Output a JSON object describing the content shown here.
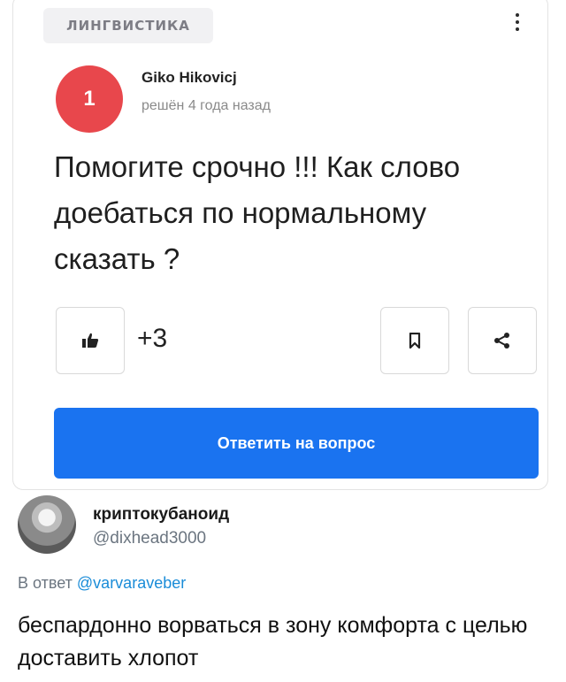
{
  "question_card": {
    "category_tag": "ЛИНГВИСТИКА",
    "rank_badge": "1",
    "author": "Giko Hikovicj",
    "status": "решён 4 года назад",
    "question": "Помогите срочно !!! Как слово доебаться по нормальному сказать ?",
    "votes": "+3",
    "answer_button": "Ответить на вопрос",
    "icons": [
      "more-vertical-icon",
      "thumbs-up-icon",
      "bookmark-icon",
      "share-icon"
    ],
    "colors": {
      "accent": "#1a73f0",
      "badge": "#e8474c"
    }
  },
  "tweet": {
    "display_name": "криптокубаноид",
    "handle": "@dixhead3000",
    "reply_prefix": "В ответ",
    "reply_to": "@varvaraveber",
    "text": "беспардонно ворваться в зону комфорта с целью доставить хлопот"
  }
}
